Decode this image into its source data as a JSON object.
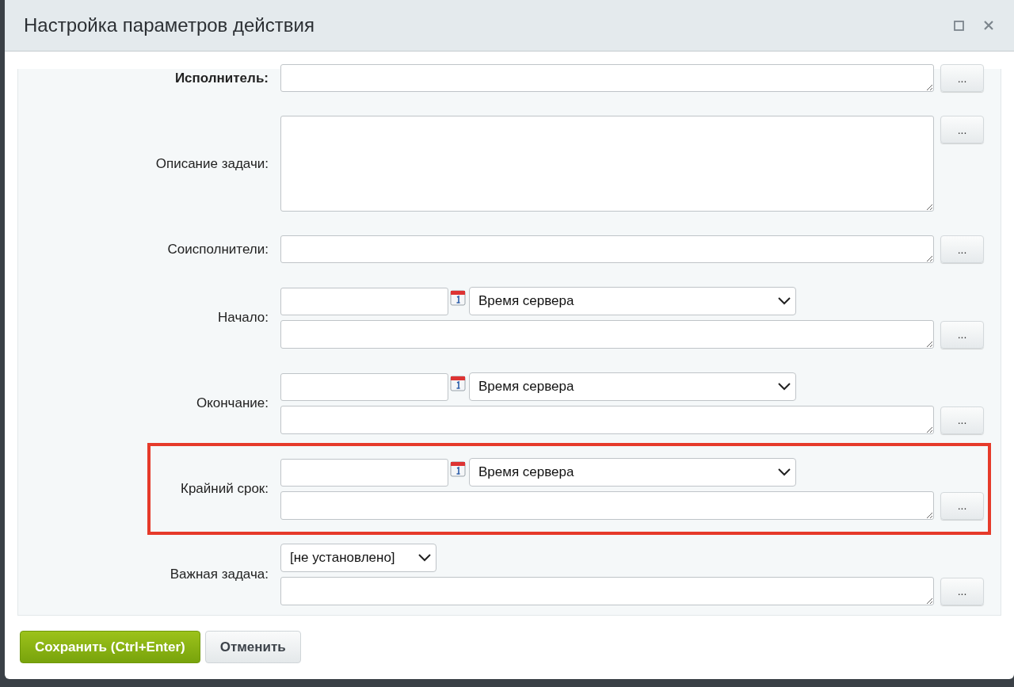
{
  "window": {
    "title": "Настройка параметров действия"
  },
  "rows": [
    {
      "kind": "text",
      "label": "Исполнитель:",
      "highlighted": false
    },
    {
      "kind": "textarea",
      "label": "Описание задачи:",
      "highlighted": false
    },
    {
      "kind": "text",
      "label": "Соисполнители:",
      "highlighted": false
    },
    {
      "kind": "datetime",
      "label": "Начало:",
      "select": "Время сервера",
      "highlighted": false
    },
    {
      "kind": "datetime",
      "label": "Окончание:",
      "select": "Время сервера",
      "highlighted": false
    },
    {
      "kind": "datetime",
      "label": "Крайний срок:",
      "select": "Время сервера",
      "highlighted": true
    },
    {
      "kind": "select",
      "label": "Важная задача:",
      "select": "[не установлено]",
      "highlighted": false
    }
  ],
  "more_button": "...",
  "buttons": [
    {
      "label": "Сохранить (Ctrl+Enter)",
      "kind": "primary"
    },
    {
      "label": "Отменить",
      "kind": "secondary"
    }
  ]
}
